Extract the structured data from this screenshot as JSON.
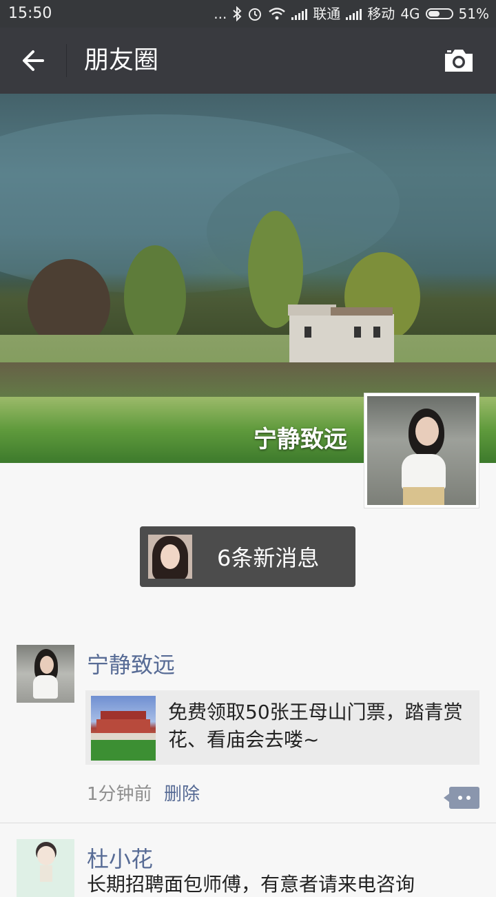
{
  "status_bar": {
    "time": "15:50",
    "dots": "...",
    "carrier1": "联通",
    "carrier2": "移动",
    "network": "4G",
    "battery": "51%",
    "battery_level": 0.51
  },
  "header": {
    "title": "朋友圈",
    "back_icon": "arrow-left-icon",
    "camera_icon": "camera-icon"
  },
  "cover": {
    "name": "宁静致远"
  },
  "new_messages": {
    "label": "6条新消息"
  },
  "posts": [
    {
      "name": "宁静致远",
      "share_text": "免费领取50张王母山门票，踏青赏花、看庙会去喽~",
      "time": "1分钟前",
      "delete_label": "删除"
    },
    {
      "name": "杜小花",
      "text": "长期招聘面包师傅，有意者请来电咨询"
    }
  ],
  "colors": {
    "header_bg": "#393a3f",
    "status_bg": "#36383b",
    "link": "#576b95",
    "feed_bg": "#f7f7f7"
  }
}
